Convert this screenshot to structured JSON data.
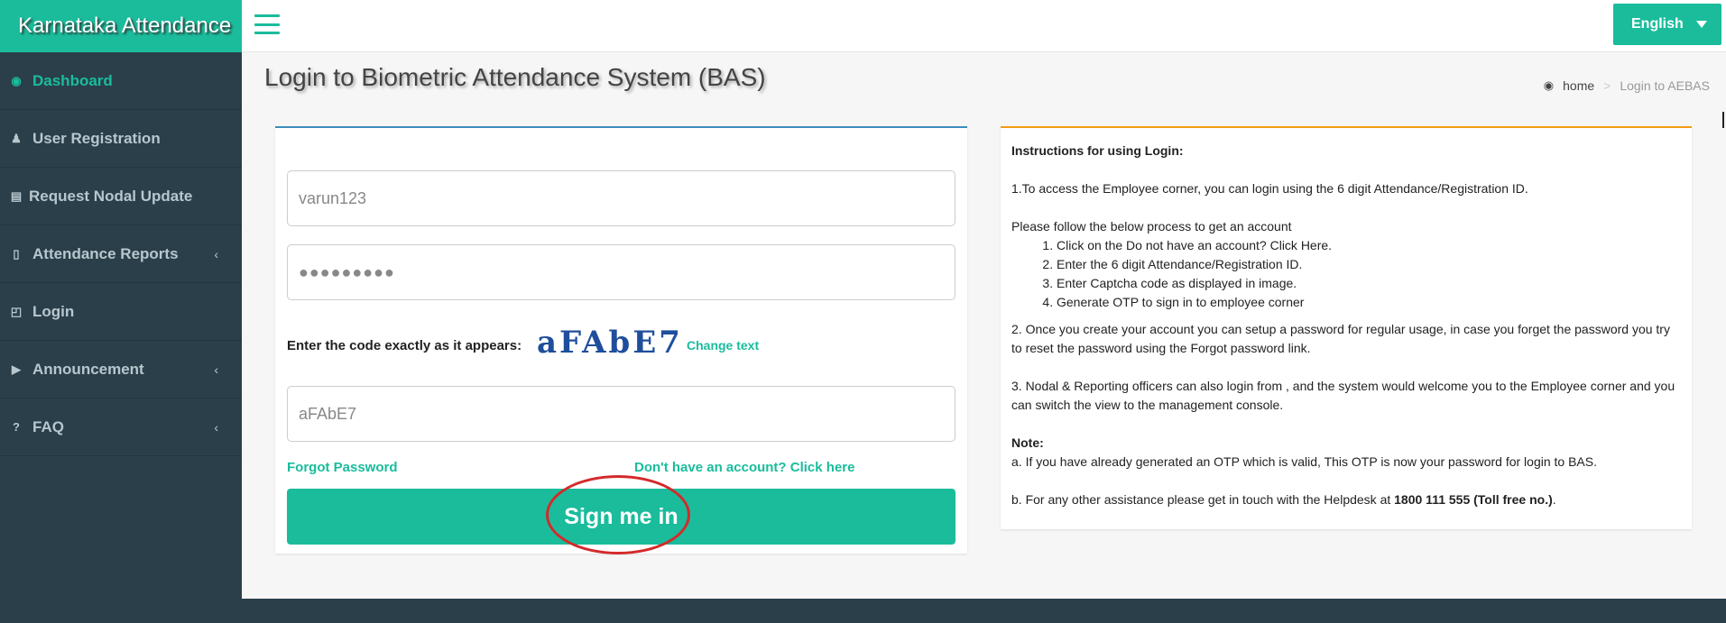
{
  "brand": {
    "title": "Karnataka Attendance"
  },
  "colors": {
    "accent": "#1abc9c",
    "sidebar_bg": "#2a3f4a",
    "login_border": "#3c8dbc",
    "instr_border": "#f39c12",
    "highlight": "#d42a2a"
  },
  "sidebar": {
    "items": [
      {
        "label": "Dashboard",
        "icon": "dashboard-icon",
        "active": true
      },
      {
        "label": "User Registration",
        "icon": "users-icon"
      },
      {
        "label": "Request Nodal Update",
        "icon": "building-icon"
      },
      {
        "label": "Attendance Reports",
        "icon": "mobile-icon",
        "submenu": true
      },
      {
        "label": "Login",
        "icon": "unlock-icon"
      },
      {
        "label": "Announcement",
        "icon": "volume-icon",
        "submenu": true
      },
      {
        "label": "FAQ",
        "icon": "question-icon",
        "submenu": true
      }
    ]
  },
  "topbar": {
    "language": "English"
  },
  "page": {
    "title": "Login to Biometric Attendance System (BAS)"
  },
  "breadcrumb": {
    "home": "home",
    "current": "Login to AEBAS"
  },
  "login": {
    "username_value": "varun123",
    "password_value": "●●●●●●●●●",
    "captcha_label": "Enter the code exactly as it appears:",
    "captcha_text": "aFAbE7",
    "change_text": "Change text",
    "captcha_value": "aFAbE7",
    "forgot": "Forgot Password",
    "signup": "Don't have an account? Click here",
    "signin": "Sign me in"
  },
  "instructions": {
    "heading": "Instructions for using Login:",
    "p1": "1.To access the Employee corner, you can login using the 6 digit Attendance/Registration ID.",
    "p2_intro": "Please follow the below process to get an account",
    "steps": [
      "Click on the Do not have an account? Click Here.",
      "Enter the 6 digit Attendance/Registration ID.",
      "Enter Captcha code as displayed in image.",
      "Generate OTP to sign in to employee corner"
    ],
    "p3": "2. Once you create your account you can setup a password for regular usage, in case you forget the password you try to reset the password using the Forgot password link.",
    "p4": "3. Nodal & Reporting officers can also login from , and the system would welcome you to the Employee corner and you can switch the view to the management console.",
    "note_heading": "Note:",
    "note_a": "a. If you have already generated an OTP which is valid, This OTP is now your password for login to BAS.",
    "note_b_prefix": "b. For any other assistance please get in touch with the Helpdesk at ",
    "note_b_phone": "1800 111 555 (Toll free no.)",
    "note_b_suffix": "."
  }
}
